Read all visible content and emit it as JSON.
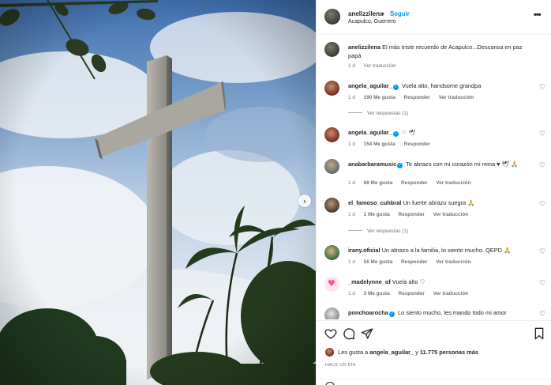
{
  "post": {
    "author": "anelizzilena",
    "follow_label": "Seguir",
    "separator": "•",
    "location": "Acapulco, Guerrero",
    "more_label": "•••",
    "carousel_next": "›"
  },
  "caption": {
    "user": "anelizzilena",
    "text": "El más triste recuerdo de Acapulco...Descansa en paz papá",
    "time": "1 d",
    "translate": "Ver traducción"
  },
  "comments": [
    {
      "user": "angela_aguilar_",
      "verified": true,
      "text": "Vuela alto, handsome grandpa",
      "time": "1 d",
      "likes": "190 Me gusta",
      "reply": "Responder",
      "translate": "Ver traducción",
      "replies_label": "Ver respuestas (1)"
    },
    {
      "user": "angela_aguilar_",
      "verified": true,
      "text": "♡ 🕊",
      "time": "1 d",
      "likes": "154 Me gusta",
      "reply": "Responder",
      "translate": "",
      "replies_label": ""
    },
    {
      "user": "anabarbaramusic",
      "verified": true,
      "text": "Te abrazo con mi corazón mi reina ♥ 🕊 🙏",
      "time": "1 d",
      "likes": "68 Me gusta",
      "reply": "Responder",
      "translate": "Ver traducción",
      "replies_label": ""
    },
    {
      "user": "el_famoso_cuhbral",
      "verified": false,
      "text": "Un fuerte abrazo suegra 🙏",
      "time": "1 d",
      "likes": "1 Me gusta",
      "reply": "Responder",
      "translate": "Ver traducción",
      "replies_label": "Ver respuestas (1)"
    },
    {
      "user": "irany.oficial",
      "verified": false,
      "text": "Un abrazo a la familia, lo siento mucho. QEPD 🙏",
      "time": "1 d",
      "likes": "56 Me gusta",
      "reply": "Responder",
      "translate": "Ver traducción",
      "replies_label": ""
    },
    {
      "user": "_madelynne_of",
      "verified": false,
      "text": "Vuela alto ♡",
      "time": "1 d",
      "likes": "3 Me gusta",
      "reply": "Responder",
      "translate": "Ver traducción",
      "replies_label": ""
    },
    {
      "user": "ponchoarocha",
      "verified": true,
      "text": "Lo siento mucho, les mando todo mi amor",
      "time": "",
      "likes": "",
      "reply": "",
      "translate": "",
      "replies_label": ""
    }
  ],
  "likes_summary": {
    "prefix": "Les gusta a",
    "user": "angela_aguilar_",
    "joiner": "y",
    "count": "11.775 personas más"
  },
  "time_ago": "HACE UN DÍA",
  "icons": {
    "like": "heart-icon",
    "comment": "comment-icon",
    "share": "share-icon",
    "save": "bookmark-icon"
  },
  "colors": {
    "accent": "#0095f6",
    "text": "#262626",
    "muted": "#737373"
  }
}
